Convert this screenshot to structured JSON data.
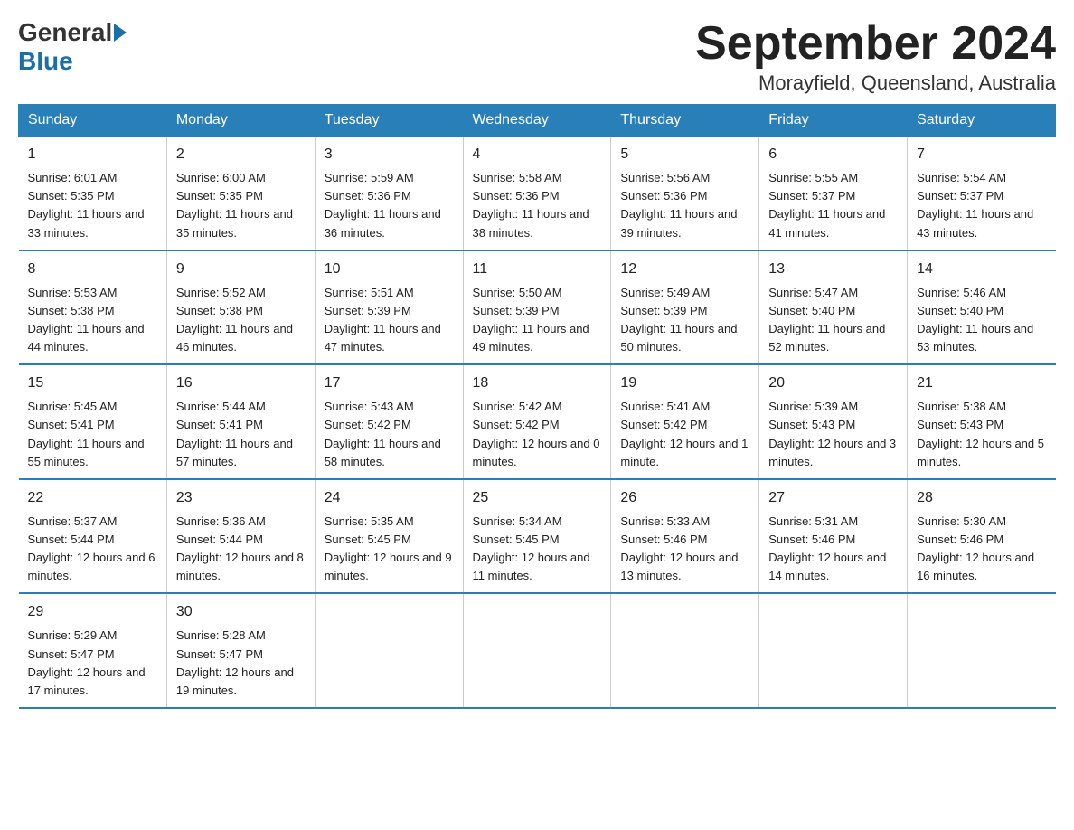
{
  "logo": {
    "general": "General",
    "blue": "Blue"
  },
  "title": "September 2024",
  "location": "Morayfield, Queensland, Australia",
  "days_header": [
    "Sunday",
    "Monday",
    "Tuesday",
    "Wednesday",
    "Thursday",
    "Friday",
    "Saturday"
  ],
  "weeks": [
    [
      {
        "num": "1",
        "sunrise": "6:01 AM",
        "sunset": "5:35 PM",
        "daylight": "11 hours and 33 minutes."
      },
      {
        "num": "2",
        "sunrise": "6:00 AM",
        "sunset": "5:35 PM",
        "daylight": "11 hours and 35 minutes."
      },
      {
        "num": "3",
        "sunrise": "5:59 AM",
        "sunset": "5:36 PM",
        "daylight": "11 hours and 36 minutes."
      },
      {
        "num": "4",
        "sunrise": "5:58 AM",
        "sunset": "5:36 PM",
        "daylight": "11 hours and 38 minutes."
      },
      {
        "num": "5",
        "sunrise": "5:56 AM",
        "sunset": "5:36 PM",
        "daylight": "11 hours and 39 minutes."
      },
      {
        "num": "6",
        "sunrise": "5:55 AM",
        "sunset": "5:37 PM",
        "daylight": "11 hours and 41 minutes."
      },
      {
        "num": "7",
        "sunrise": "5:54 AM",
        "sunset": "5:37 PM",
        "daylight": "11 hours and 43 minutes."
      }
    ],
    [
      {
        "num": "8",
        "sunrise": "5:53 AM",
        "sunset": "5:38 PM",
        "daylight": "11 hours and 44 minutes."
      },
      {
        "num": "9",
        "sunrise": "5:52 AM",
        "sunset": "5:38 PM",
        "daylight": "11 hours and 46 minutes."
      },
      {
        "num": "10",
        "sunrise": "5:51 AM",
        "sunset": "5:39 PM",
        "daylight": "11 hours and 47 minutes."
      },
      {
        "num": "11",
        "sunrise": "5:50 AM",
        "sunset": "5:39 PM",
        "daylight": "11 hours and 49 minutes."
      },
      {
        "num": "12",
        "sunrise": "5:49 AM",
        "sunset": "5:39 PM",
        "daylight": "11 hours and 50 minutes."
      },
      {
        "num": "13",
        "sunrise": "5:47 AM",
        "sunset": "5:40 PM",
        "daylight": "11 hours and 52 minutes."
      },
      {
        "num": "14",
        "sunrise": "5:46 AM",
        "sunset": "5:40 PM",
        "daylight": "11 hours and 53 minutes."
      }
    ],
    [
      {
        "num": "15",
        "sunrise": "5:45 AM",
        "sunset": "5:41 PM",
        "daylight": "11 hours and 55 minutes."
      },
      {
        "num": "16",
        "sunrise": "5:44 AM",
        "sunset": "5:41 PM",
        "daylight": "11 hours and 57 minutes."
      },
      {
        "num": "17",
        "sunrise": "5:43 AM",
        "sunset": "5:42 PM",
        "daylight": "11 hours and 58 minutes."
      },
      {
        "num": "18",
        "sunrise": "5:42 AM",
        "sunset": "5:42 PM",
        "daylight": "12 hours and 0 minutes."
      },
      {
        "num": "19",
        "sunrise": "5:41 AM",
        "sunset": "5:42 PM",
        "daylight": "12 hours and 1 minute."
      },
      {
        "num": "20",
        "sunrise": "5:39 AM",
        "sunset": "5:43 PM",
        "daylight": "12 hours and 3 minutes."
      },
      {
        "num": "21",
        "sunrise": "5:38 AM",
        "sunset": "5:43 PM",
        "daylight": "12 hours and 5 minutes."
      }
    ],
    [
      {
        "num": "22",
        "sunrise": "5:37 AM",
        "sunset": "5:44 PM",
        "daylight": "12 hours and 6 minutes."
      },
      {
        "num": "23",
        "sunrise": "5:36 AM",
        "sunset": "5:44 PM",
        "daylight": "12 hours and 8 minutes."
      },
      {
        "num": "24",
        "sunrise": "5:35 AM",
        "sunset": "5:45 PM",
        "daylight": "12 hours and 9 minutes."
      },
      {
        "num": "25",
        "sunrise": "5:34 AM",
        "sunset": "5:45 PM",
        "daylight": "12 hours and 11 minutes."
      },
      {
        "num": "26",
        "sunrise": "5:33 AM",
        "sunset": "5:46 PM",
        "daylight": "12 hours and 13 minutes."
      },
      {
        "num": "27",
        "sunrise": "5:31 AM",
        "sunset": "5:46 PM",
        "daylight": "12 hours and 14 minutes."
      },
      {
        "num": "28",
        "sunrise": "5:30 AM",
        "sunset": "5:46 PM",
        "daylight": "12 hours and 16 minutes."
      }
    ],
    [
      {
        "num": "29",
        "sunrise": "5:29 AM",
        "sunset": "5:47 PM",
        "daylight": "12 hours and 17 minutes."
      },
      {
        "num": "30",
        "sunrise": "5:28 AM",
        "sunset": "5:47 PM",
        "daylight": "12 hours and 19 minutes."
      },
      null,
      null,
      null,
      null,
      null
    ]
  ]
}
